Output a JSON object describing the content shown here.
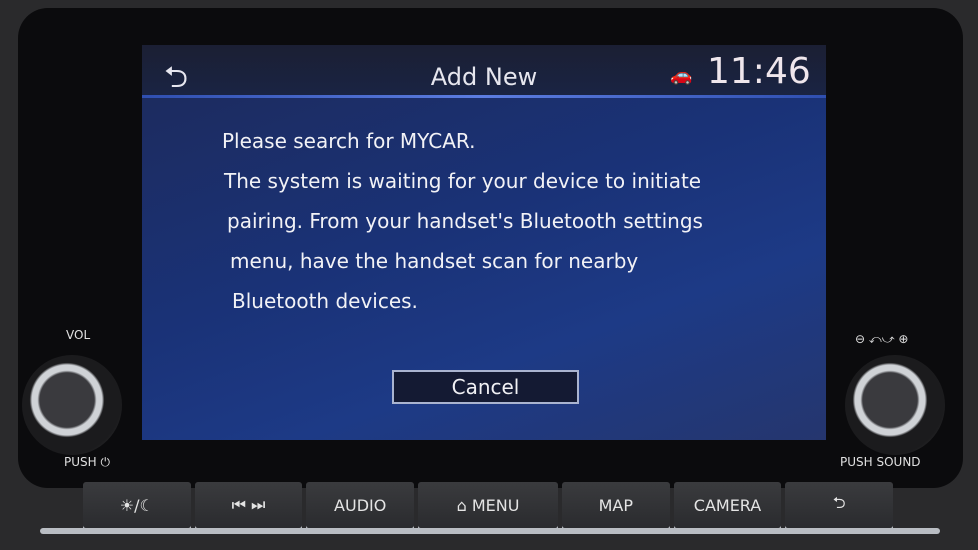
{
  "header": {
    "title": "Add New",
    "time": "11:46",
    "back_icon": "back-arrow-icon",
    "status_icon": "phone-car-connection-icon"
  },
  "message": {
    "lines": [
      "Please search for MYCAR.",
      "The system is waiting for your device to initiate",
      "pairing. From your handset's Bluetooth settings",
      "menu, have the handset scan for nearby",
      "Bluetooth devices."
    ]
  },
  "dialog": {
    "cancel_label": "Cancel"
  },
  "knobs": {
    "left_top": "VOL",
    "left_bottom": "PUSH ⏻",
    "right_bottom": "PUSH SOUND"
  },
  "hard_buttons": {
    "brightness": "☀/☾",
    "track": "⏮  ⏭",
    "audio": "AUDIO",
    "menu": "⌂ MENU",
    "map": "MAP",
    "camera": "CAMERA",
    "back": "⮌"
  }
}
